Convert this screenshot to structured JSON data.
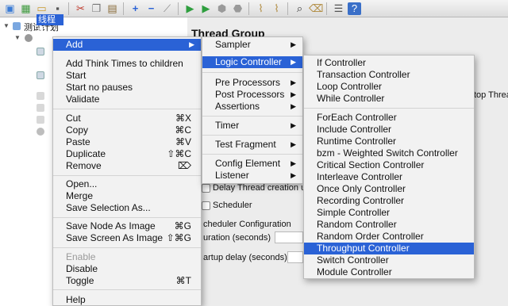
{
  "toolbar": {
    "icons": [
      "new-icon",
      "templates-icon",
      "open-icon",
      "save-icon",
      "cut-icon",
      "copy-icon",
      "paste-icon",
      "expand-icon",
      "collapse-icon",
      "toggle-icon",
      "start-icon",
      "start-no-pause-icon",
      "stop-icon",
      "shutdown-icon",
      "clear-icon",
      "clear-all-icon",
      "search-icon",
      "reset-search-icon",
      "function-helper-icon",
      "help-icon"
    ]
  },
  "tree": {
    "root_label": "测试计划",
    "selected_label": "线程组"
  },
  "panel": {
    "title": "Thread Group",
    "stop_thread_fragment": "top Threa",
    "delay_thread_creation": "Delay Thread creation u",
    "scheduler": "Scheduler",
    "scheduler_configuration": "cheduler Configuration",
    "duration": "uration (seconds)",
    "startup_delay": "artup delay (seconds)"
  },
  "context_menu": {
    "add": "Add",
    "add_think_times": "Add Think Times to children",
    "start": "Start",
    "start_no_pauses": "Start no pauses",
    "validate": "Validate",
    "cut": "Cut",
    "cut_sc": "⌘X",
    "copy": "Copy",
    "copy_sc": "⌘C",
    "paste": "Paste",
    "paste_sc": "⌘V",
    "duplicate": "Duplicate",
    "duplicate_sc": "⇧⌘C",
    "remove": "Remove",
    "remove_sc": "⌦",
    "open": "Open...",
    "merge": "Merge",
    "save_selection_as": "Save Selection As...",
    "save_node_as_image": "Save Node As Image",
    "save_node_sc": "⌘G",
    "save_screen_as_image": "Save Screen As Image",
    "save_screen_sc": "⇧⌘G",
    "enable": "Enable",
    "disable": "Disable",
    "toggle": "Toggle",
    "toggle_sc": "⌘T",
    "help": "Help"
  },
  "add_menu": {
    "sampler": "Sampler",
    "logic_controller": "Logic Controller",
    "pre_processors": "Pre Processors",
    "post_processors": "Post Processors",
    "assertions": "Assertions",
    "timer": "Timer",
    "test_fragment": "Test Fragment",
    "config_element": "Config Element",
    "listener": "Listener"
  },
  "logic_menu": {
    "items": [
      "If Controller",
      "Transaction Controller",
      "Loop Controller",
      "While Controller",
      "ForEach Controller",
      "Include Controller",
      "Runtime Controller",
      "bzm - Weighted Switch Controller",
      "Critical Section Controller",
      "Interleave Controller",
      "Once Only Controller",
      "Recording Controller",
      "Simple Controller",
      "Random Controller",
      "Random Order Controller",
      "Throughput Controller",
      "Switch Controller",
      "Module Controller"
    ],
    "highlighted": "Throughput Controller"
  },
  "colors": {
    "highlight": "#2a62d6",
    "menu_bg": "#f2f2f2"
  }
}
